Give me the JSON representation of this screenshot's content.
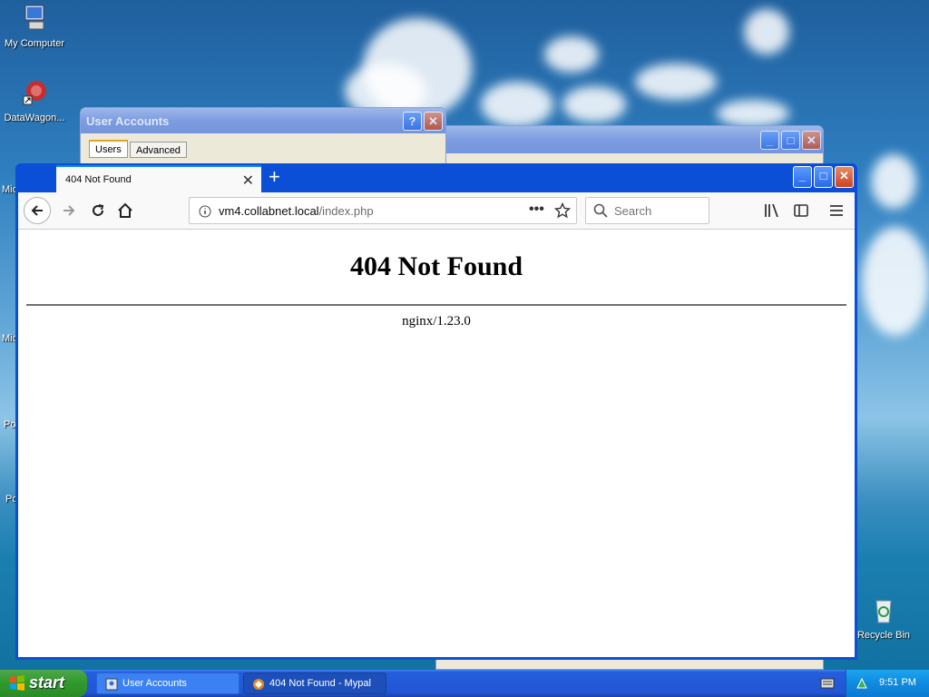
{
  "desktop": {
    "icons": [
      {
        "label": "My Computer"
      },
      {
        "label": "DataWagon..."
      },
      {
        "label": "Recycle Bin"
      }
    ],
    "partial_labels": [
      "Mic",
      "Mic",
      "Po",
      "Po"
    ]
  },
  "user_accounts": {
    "title": "User Accounts",
    "tabs": [
      "Users",
      "Advanced"
    ],
    "help_glyph": "?",
    "close_glyph": "✕"
  },
  "firefox": {
    "tab_title": "404 Not Found",
    "tab_close": "✕",
    "new_tab": "+",
    "url_host": "vm4.collabnet.local",
    "url_path": "/index.php",
    "search_placeholder": "Search",
    "page": {
      "heading": "404 Not Found",
      "server": "nginx/1.23.0"
    }
  },
  "taskbar": {
    "start_label": "start",
    "tasks": [
      {
        "label": "User Accounts",
        "active": false
      },
      {
        "label": "404 Not Found - Mypal",
        "active": true
      }
    ],
    "clock": "9:51 PM"
  },
  "colors": {
    "xp_blue": "#0b4fd6",
    "firefox_accent": "#0a84ff",
    "start_green": "#2f9a2a"
  }
}
